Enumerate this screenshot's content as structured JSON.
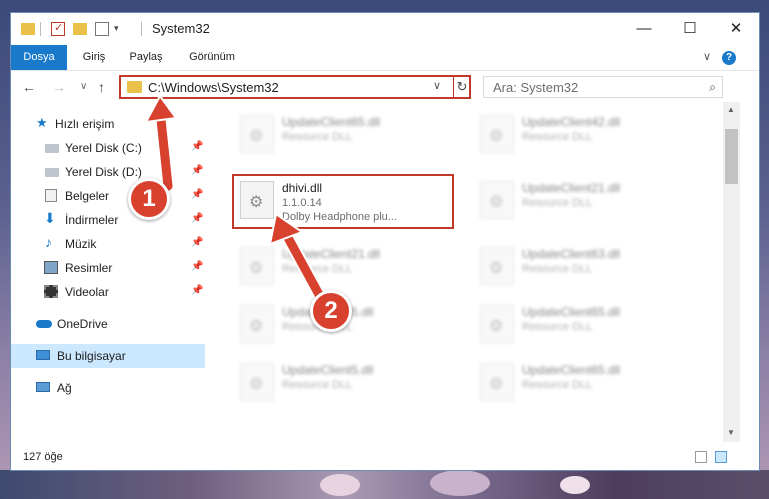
{
  "window": {
    "title": "System32",
    "minimize": "—",
    "maximize": "☐",
    "close": "✕"
  },
  "ribbon": {
    "tabs": [
      "Dosya",
      "Giriş",
      "Paylaş",
      "Görünüm"
    ],
    "expand": "∨",
    "help": "?"
  },
  "address": {
    "path": "C:\\Windows\\System32",
    "dropdown": "∨",
    "refresh": "↻"
  },
  "nav_buttons": {
    "back": "←",
    "forward": "→",
    "history": "∨",
    "up": "↑"
  },
  "search": {
    "placeholder": "Ara: System32",
    "icon": "search-icon"
  },
  "sidebar": {
    "items": [
      {
        "label": "Hızlı erişim",
        "icon": "star-icon",
        "pinned": false
      },
      {
        "label": "Yerel Disk (C:)",
        "icon": "drive-icon",
        "pinned": true
      },
      {
        "label": "Yerel Disk (D:)",
        "icon": "drive-icon",
        "pinned": true
      },
      {
        "label": "Belgeler",
        "icon": "documents-icon",
        "pinned": true
      },
      {
        "label": "İndirmeler",
        "icon": "download-icon",
        "pinned": true
      },
      {
        "label": "Müzik",
        "icon": "music-icon",
        "pinned": true
      },
      {
        "label": "Resimler",
        "icon": "pictures-icon",
        "pinned": true
      },
      {
        "label": "Videolar",
        "icon": "videos-icon",
        "pinned": true
      },
      {
        "label": "OneDrive",
        "icon": "cloud-icon",
        "pinned": false
      },
      {
        "label": "Bu bilgisayar",
        "icon": "computer-icon",
        "pinned": false,
        "selected": true
      },
      {
        "label": "Ağ",
        "icon": "network-icon",
        "pinned": false
      }
    ]
  },
  "files": [
    {
      "name": "UpdateClient65.dll",
      "type": "Resource DLL",
      "blurred": true
    },
    {
      "name": "UpdateClient42.dll",
      "type": "Resource DLL",
      "blurred": true
    },
    {
      "name": "dhivi.dll",
      "version": "1.1.0.14",
      "description": "Dolby Headphone plu...",
      "blurred": false
    },
    {
      "name": "UpdateClient21.dll",
      "type": "Resource DLL",
      "blurred": true
    },
    {
      "name": "UpdateClient21.dll",
      "type": "Resource DLL",
      "blurred": true
    },
    {
      "name": "UpdateClient63.dll",
      "type": "Resource DLL",
      "blurred": true
    },
    {
      "name": "UpdateClient5.dll",
      "type": "Resource DLL",
      "blurred": true
    },
    {
      "name": "UpdateClient65.dll",
      "type": "Resource DLL",
      "blurred": true
    },
    {
      "name": "UpdateClient5.dll",
      "type": "Resource DLL",
      "blurred": true
    },
    {
      "name": "UpdateClient65.dll",
      "type": "Resource DLL",
      "blurred": true
    }
  ],
  "status": {
    "count": "127 öğe"
  },
  "callouts": [
    "1",
    "2"
  ],
  "colors": {
    "accent": "#1979ca",
    "highlight": "#c0392b",
    "selected_nav": "#cce8ff"
  }
}
